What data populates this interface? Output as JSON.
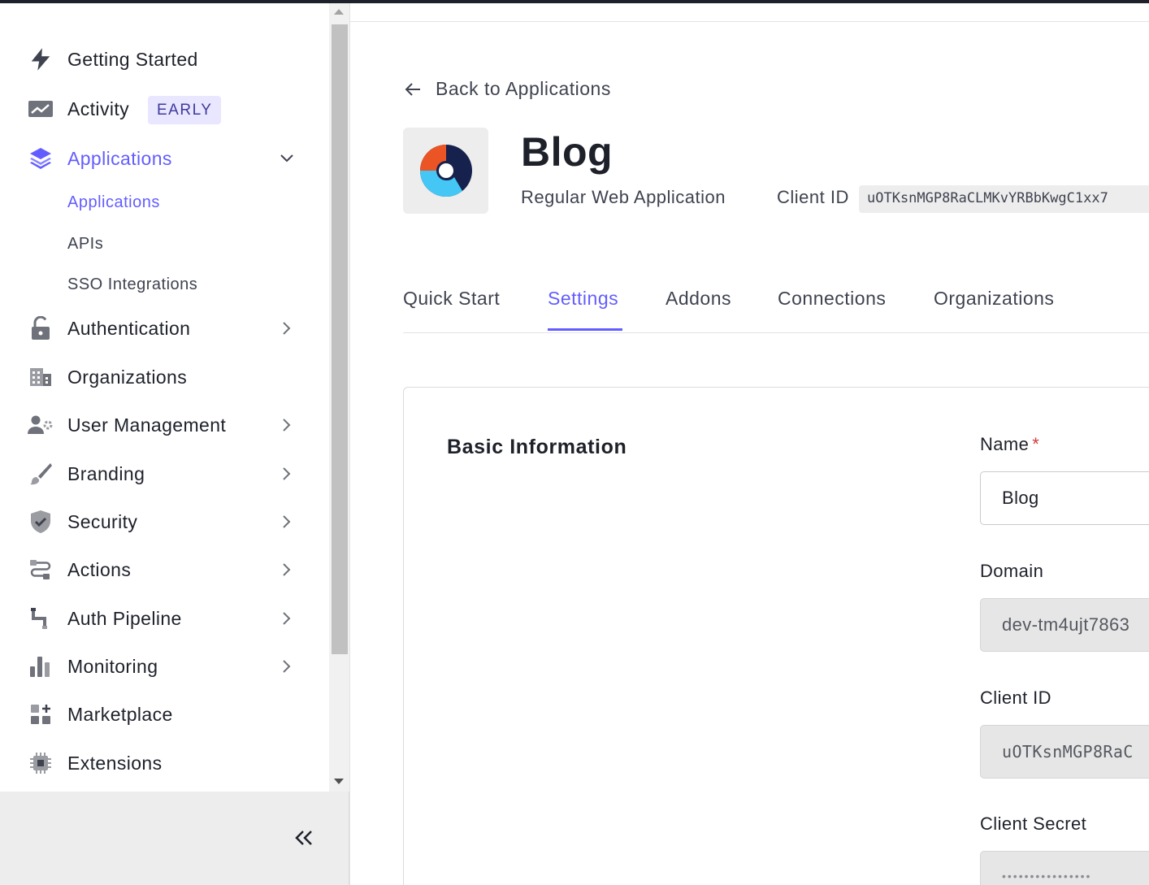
{
  "sidebar": {
    "items": [
      {
        "label": "Getting Started",
        "icon": "bolt-icon"
      },
      {
        "label": "Activity",
        "icon": "activity-chart-icon",
        "badge": "EARLY"
      },
      {
        "label": "Applications",
        "icon": "layers-icon",
        "expanded": true,
        "children": [
          {
            "label": "Applications",
            "active": true
          },
          {
            "label": "APIs"
          },
          {
            "label": "SSO Integrations"
          }
        ]
      },
      {
        "label": "Authentication",
        "icon": "lock-icon"
      },
      {
        "label": "Organizations",
        "icon": "building-icon"
      },
      {
        "label": "User Management",
        "icon": "user-gear-icon"
      },
      {
        "label": "Branding",
        "icon": "paintbrush-icon"
      },
      {
        "label": "Security",
        "icon": "shield-check-icon"
      },
      {
        "label": "Actions",
        "icon": "flow-icon"
      },
      {
        "label": "Auth Pipeline",
        "icon": "pipe-icon"
      },
      {
        "label": "Monitoring",
        "icon": "bar-chart-icon"
      },
      {
        "label": "Marketplace",
        "icon": "grid-plus-icon"
      },
      {
        "label": "Extensions",
        "icon": "chip-icon"
      }
    ]
  },
  "header": {
    "back_label": "Back to Applications",
    "app_title": "Blog",
    "app_type": "Regular Web Application",
    "client_id_label": "Client ID",
    "client_id_value": "uOTKsnMGP8RaCLMKvYRBbKwgC1xx7"
  },
  "tabs": [
    {
      "label": "Quick Start"
    },
    {
      "label": "Settings",
      "active": true
    },
    {
      "label": "Addons"
    },
    {
      "label": "Connections"
    },
    {
      "label": "Organizations"
    }
  ],
  "settings": {
    "section_title": "Basic Information",
    "name_label": "Name",
    "required_mark": "*",
    "name_value": "Blog",
    "domain_label": "Domain",
    "domain_value": "dev-tm4ujt7863",
    "client_id_label": "Client ID",
    "client_id_value": "uOTKsnMGP8RaC",
    "client_secret_label": "Client Secret",
    "client_secret_value": "••••••••••••••••"
  },
  "colors": {
    "accent": "#635dff",
    "badge_bg": "#e9e6ff",
    "required": "#d03c38"
  }
}
